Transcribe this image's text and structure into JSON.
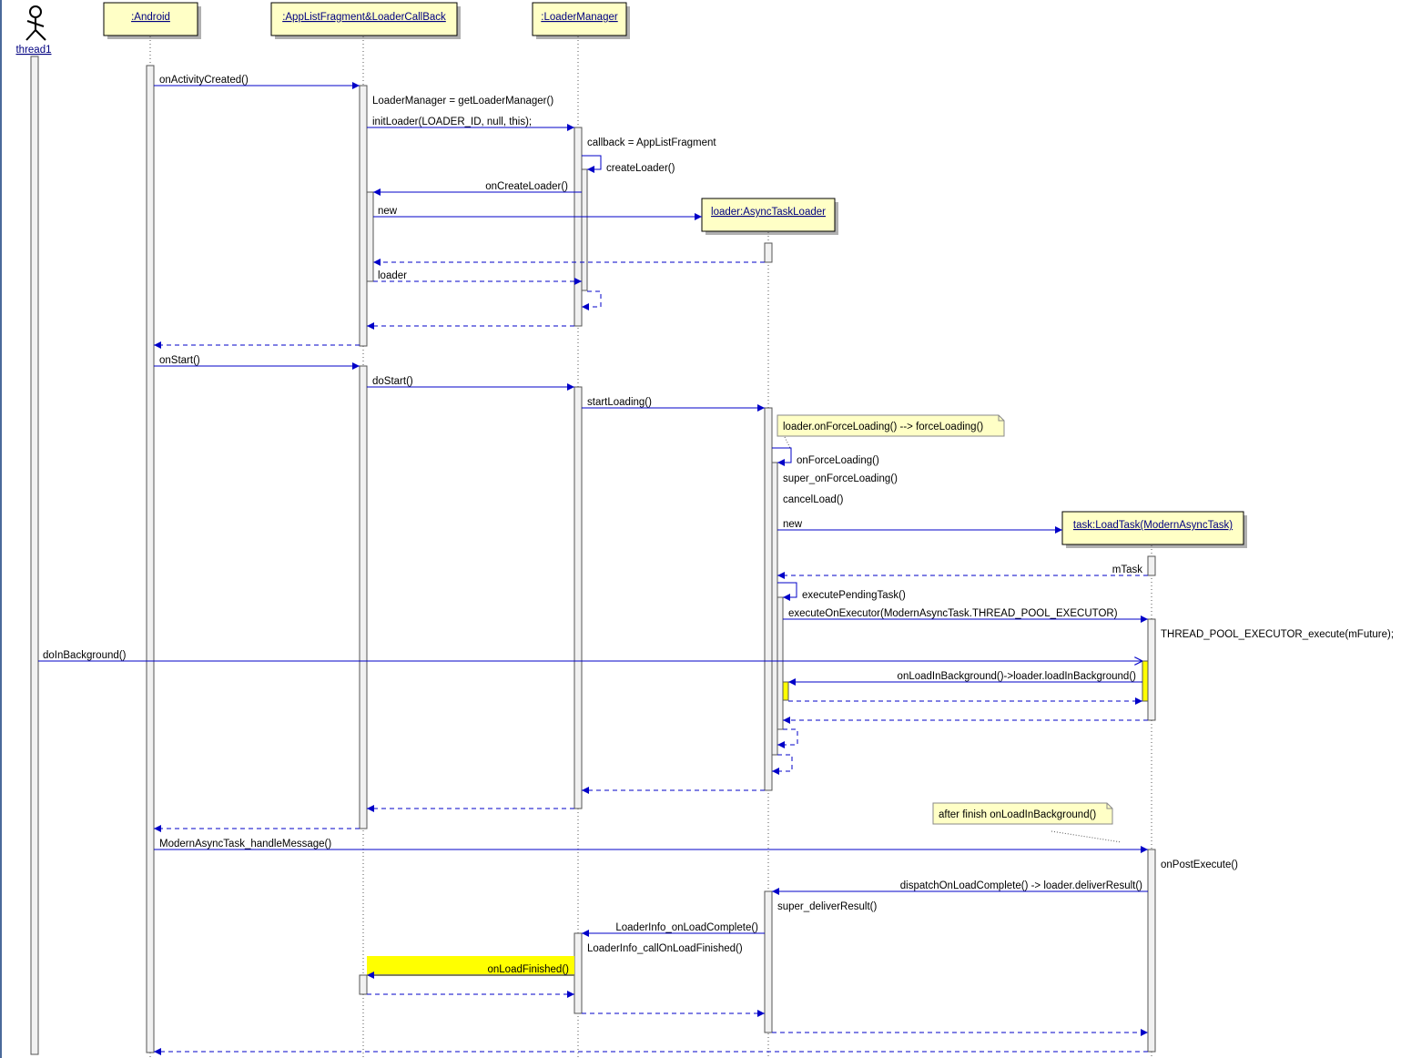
{
  "actor": {
    "label": "thread1"
  },
  "participants": [
    {
      "id": "android",
      "label": ":Android"
    },
    {
      "id": "fragment",
      "label": ":AppListFragment&LoaderCallBack"
    },
    {
      "id": "loadermanager",
      "label": ":LoaderManager"
    },
    {
      "id": "loader",
      "label": "loader:AsyncTaskLoader"
    },
    {
      "id": "task",
      "label": "task:LoadTask(ModernAsyncTask)"
    }
  ],
  "messages": [
    {
      "id": "m01",
      "text": "onActivityCreated()"
    },
    {
      "id": "m02",
      "text": "LoaderManager = getLoaderManager()"
    },
    {
      "id": "m03",
      "text": "initLoader(LOADER_ID, null, this);"
    },
    {
      "id": "m04",
      "text": "callback = AppListFragment"
    },
    {
      "id": "m05",
      "text": "createLoader()"
    },
    {
      "id": "m06",
      "text": "onCreateLoader()"
    },
    {
      "id": "m07",
      "text": "new"
    },
    {
      "id": "m08",
      "text": "loader"
    },
    {
      "id": "m09",
      "text": "onStart()"
    },
    {
      "id": "m10",
      "text": "doStart()"
    },
    {
      "id": "m11",
      "text": "startLoading()"
    },
    {
      "id": "m12",
      "text": "onForceLoading()"
    },
    {
      "id": "m13",
      "text": "super_onForceLoading()"
    },
    {
      "id": "m14",
      "text": "cancelLoad()"
    },
    {
      "id": "m15",
      "text": "new"
    },
    {
      "id": "m16",
      "text": "mTask"
    },
    {
      "id": "m17",
      "text": "executePendingTask()"
    },
    {
      "id": "m18",
      "text": "executeOnExecutor(ModernAsyncTask.THREAD_POOL_EXECUTOR)"
    },
    {
      "id": "m19",
      "text": "THREAD_POOL_EXECUTOR_execute(mFuture);"
    },
    {
      "id": "m20",
      "text": "doInBackground()"
    },
    {
      "id": "m21",
      "text": "onLoadInBackground()->loader.loadInBackground()"
    },
    {
      "id": "m22",
      "text": "ModernAsyncTask_handleMessage()"
    },
    {
      "id": "m23",
      "text": "onPostExecute()"
    },
    {
      "id": "m24",
      "text": "dispatchOnLoadComplete() -> loader.deliverResult()"
    },
    {
      "id": "m25",
      "text": "super_deliverResult()"
    },
    {
      "id": "m26",
      "text": "LoaderInfo_onLoadComplete()"
    },
    {
      "id": "m27",
      "text": "LoaderInfo_callOnLoadFinished()"
    },
    {
      "id": "m28",
      "text": "onLoadFinished()"
    }
  ],
  "notes": [
    {
      "id": "n1",
      "text": "loader.onForceLoading() --> forceLoading()"
    },
    {
      "id": "n2",
      "text": "after finish onLoadInBackground()"
    }
  ],
  "colors": {
    "message": "#0000c8",
    "object_box": "#ffffc6",
    "activation": "#f1f1f1",
    "highlight": "#ffff00",
    "object_label": "#000080"
  }
}
